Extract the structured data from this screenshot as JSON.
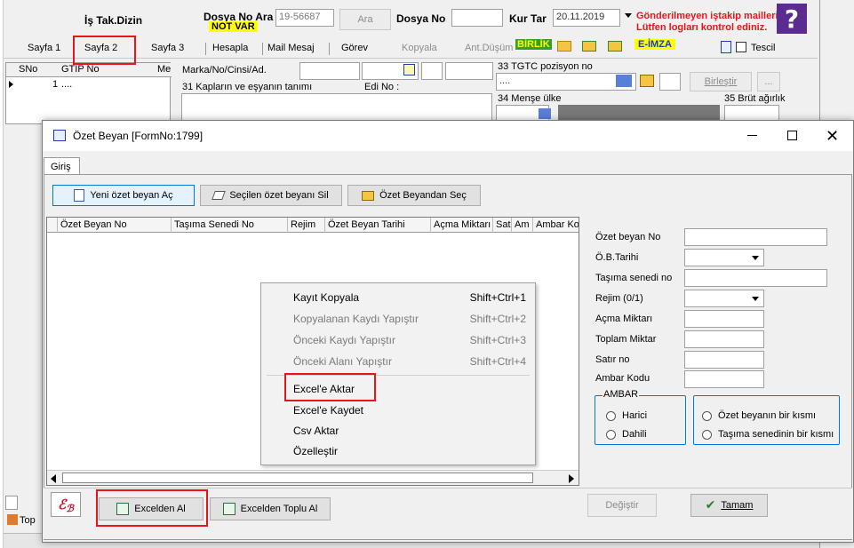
{
  "top": {
    "is_tak_dizin": "İş Tak.Dizin",
    "dosya_no_ara": "Dosya No Ara",
    "not_var": "NOT VAR",
    "search_value": "19-56687",
    "ara_button": "Ara",
    "dosya_no_label": "Dosya No",
    "kur_tar_label": "Kur Tar",
    "kur_tar_value": "20.11.2019",
    "warning_line1": "Gönderilmeyen iştakip mailleri",
    "warning_line2": "Lütfen logları kontrol ediniz.",
    "colors": {
      "warning": "#e8151b",
      "help_bg": "#5b2c8f",
      "not_var_bg": "#ffff00"
    }
  },
  "tabs": {
    "sayfa1": "Sayfa 1",
    "sayfa2": "Sayfa 2",
    "sayfa3": "Sayfa 3",
    "hesapla": "Hesapla",
    "mail_mesaj": "Mail Mesaj",
    "gorev": "Görev",
    "kopyala": "Kopyala",
    "ant_dusum": "Ant.Düşüm",
    "birlik": "BİRLİK",
    "e_imza": "E-İMZA",
    "tescil": "Tescil"
  },
  "bg_form": {
    "grid_cols": [
      "SNo",
      "GTIP No",
      "Me"
    ],
    "grid_row_no": "1",
    "grid_row_val": "....",
    "marka_label": "Marka/No/Cinsi/Ad.",
    "kaplar_label": "31 Kapların ve eşyanın tanımı",
    "edi_no_label": "Edi No :",
    "gtc_label": "33 TGTC pozisyon no",
    "gtc_value": "....",
    "birlestir": "Birleştir",
    "dots": "...",
    "mense_label": "34 Menşe ülke",
    "brut_label": "35 Brüt ağırlık",
    "top_label": "Top"
  },
  "dialog": {
    "title": "Özet Beyan [FormNo:1799]",
    "tab_giris": "Giriş",
    "yeni_button": "Yeni özet beyan Aç",
    "sil_button": "Seçilen özet beyanı Sil",
    "sec_button": "Özet Beyandan Seç",
    "columns": [
      "Özet Beyan No",
      "Taşıma Senedi No",
      "Rejim",
      "Özet Beyan Tarihi",
      "Açma Miktarı",
      "Sat",
      "Am",
      "Ambar Ko"
    ],
    "form": {
      "ozet_beyan_no": "Özet beyan No",
      "ob_tarihi": "Ö.B.Tarihi",
      "tasima_senedi_no": "Taşıma senedi no",
      "rejim": "Rejim  (0/1)",
      "acma_miktari": "Açma Miktarı",
      "toplam_miktar": "Toplam Miktar",
      "satir_no": "Satır no",
      "ambar_kodu": "Ambar Kodu",
      "ambar_group": "AMBAR",
      "harici": "Harici",
      "dahili": "Dahili",
      "kisim1": "Özet beyanın bir kısmı",
      "kisim2": "Taşıma senedinin bir kısmı"
    },
    "excelden_al": "Excelden Al",
    "excelden_toplu_al": "Excelden Toplu Al",
    "degistir": "Değiştir",
    "tamam": "Tamam"
  },
  "context_menu": {
    "items": [
      {
        "label": "Kayıt Kopyala",
        "shortcut": "Shift+Ctrl+1"
      },
      {
        "label": "Kopyalanan Kaydı Yapıştır",
        "shortcut": "Shift+Ctrl+2"
      },
      {
        "label": "Önceki Kaydı Yapıştır",
        "shortcut": "Shift+Ctrl+3"
      },
      {
        "label": "Önceki Alanı Yapıştır",
        "shortcut": "Shift+Ctrl+4"
      },
      {
        "label": "Excel'e Aktar",
        "shortcut": ""
      },
      {
        "label": "Excel'e Kaydet",
        "shortcut": ""
      },
      {
        "label": "Csv Aktar",
        "shortcut": ""
      },
      {
        "label": "Özelleştir",
        "shortcut": ""
      }
    ]
  }
}
